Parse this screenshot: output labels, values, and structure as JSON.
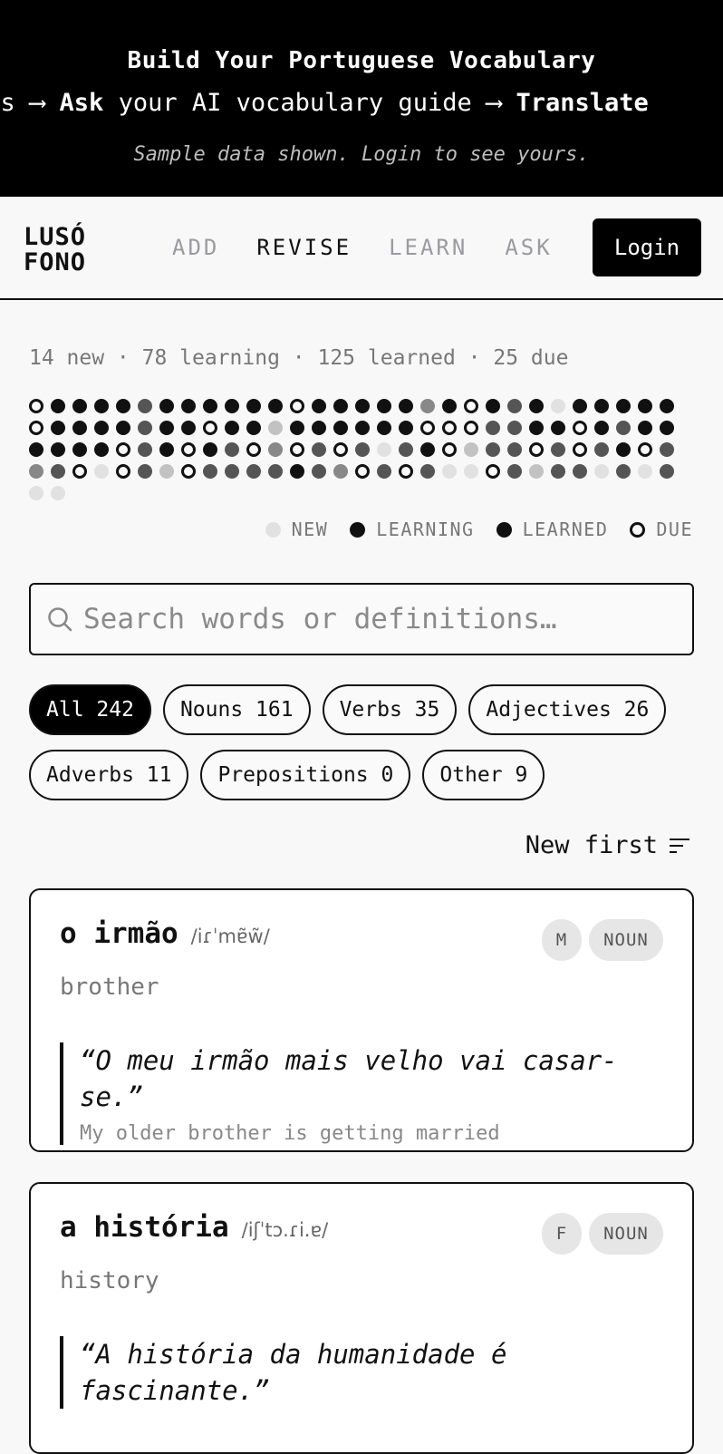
{
  "banner": {
    "title": "Build Your Portuguese Vocabulary",
    "marquee": [
      {
        "text": "lls ⟶ ",
        "bold": false
      },
      {
        "text": "Ask",
        "bold": true
      },
      {
        "text": " your AI vocabulary guide ⟶ ",
        "bold": false
      },
      {
        "text": "Translate",
        "bold": true
      }
    ],
    "note": "Sample data shown. Login to see yours."
  },
  "nav": {
    "logo_line1": "LUSÓ",
    "logo_line2": "FONO",
    "links": [
      {
        "label": "ADD",
        "active": false
      },
      {
        "label": "REVISE",
        "active": true
      },
      {
        "label": "LEARN",
        "active": false
      },
      {
        "label": "ASK",
        "active": false
      }
    ],
    "login_label": "Login"
  },
  "stats": {
    "summary": "14 new · 78 learning · 125 learned · 25 due",
    "grid": [
      "D",
      "K",
      "K",
      "K",
      "K",
      "G",
      "K",
      "K",
      "K",
      "K",
      "K",
      "K",
      "D",
      "K",
      "K",
      "K",
      "K",
      "K",
      "M",
      "K",
      "D",
      "K",
      "G",
      "K",
      "N",
      "K",
      "K",
      "K",
      "K",
      "K",
      "D",
      "K",
      "K",
      "K",
      "K",
      "G",
      "K",
      "K",
      "D",
      "K",
      "K",
      "L",
      "K",
      "K",
      "K",
      "K",
      "K",
      "K",
      "D",
      "D",
      "D",
      "G",
      "G",
      "K",
      "K",
      "D",
      "K",
      "G",
      "K",
      "K",
      "K",
      "K",
      "K",
      "K",
      "D",
      "G",
      "K",
      "D",
      "K",
      "G",
      "D",
      "M",
      "D",
      "G",
      "D",
      "G",
      "N",
      "G",
      "K",
      "D",
      "L",
      "G",
      "G",
      "D",
      "G",
      "D",
      "G",
      "K",
      "D",
      "G",
      "M",
      "G",
      "D",
      "N",
      "D",
      "G",
      "L",
      "D",
      "G",
      "G",
      "G",
      "G",
      "K",
      "G",
      "M",
      "D",
      "G",
      "D",
      "G",
      "N",
      "N",
      "D",
      "G",
      "L",
      "G",
      "G",
      "N",
      "G",
      "N",
      "G",
      "N",
      "N"
    ],
    "legend": [
      {
        "label": "NEW",
        "color": "#e1e1e1"
      },
      {
        "label": "LEARNING",
        "color": "#111111"
      },
      {
        "label": "LEARNED",
        "color": "#111111"
      },
      {
        "label": "DUE",
        "color": "ring"
      }
    ]
  },
  "search": {
    "placeholder": "Search words or definitions…",
    "value": ""
  },
  "filters": [
    {
      "label": "All 242",
      "active": true
    },
    {
      "label": "Nouns 161",
      "active": false
    },
    {
      "label": "Verbs 35",
      "active": false
    },
    {
      "label": "Adjectives 26",
      "active": false
    },
    {
      "label": "Adverbs 11",
      "active": false
    },
    {
      "label": "Prepositions 0",
      "active": false
    },
    {
      "label": "Other 9",
      "active": false
    }
  ],
  "sort": {
    "label": "New first"
  },
  "cards": [
    {
      "word": "o irmão",
      "ipa": "/iɾˈmɐ̃w̃/",
      "gender": "M",
      "pos": "NOUN",
      "definition": "brother",
      "example_pt": "“O meu irmão mais velho vai casar-se.”",
      "example_en": "My older brother is getting married"
    },
    {
      "word": "a história",
      "ipa": "/iʃˈtɔ.ɾi.ɐ/",
      "gender": "F",
      "pos": "NOUN",
      "definition": "history",
      "example_pt": "“A história da humanidade é fascinante.”",
      "example_en": ""
    }
  ]
}
